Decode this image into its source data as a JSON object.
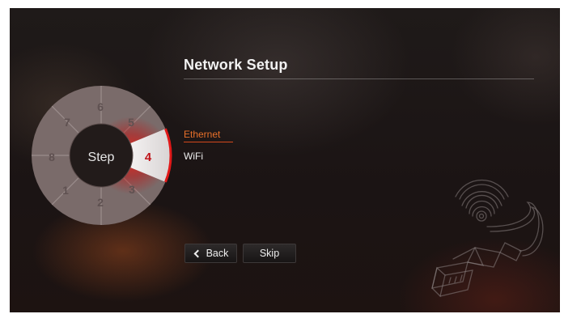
{
  "header": {
    "title": "Network Setup"
  },
  "step_wheel": {
    "center_label": "Step",
    "current_step": "4",
    "steps": [
      "1",
      "2",
      "3",
      "5",
      "6",
      "7",
      "8"
    ]
  },
  "network_options": [
    {
      "label": "Ethernet",
      "selected": true
    },
    {
      "label": "WiFi",
      "selected": false
    }
  ],
  "buttons": {
    "back_label": "Back",
    "skip_label": "Skip"
  },
  "colors": {
    "accent": "#e8702a",
    "active_step": "#c0151b"
  }
}
